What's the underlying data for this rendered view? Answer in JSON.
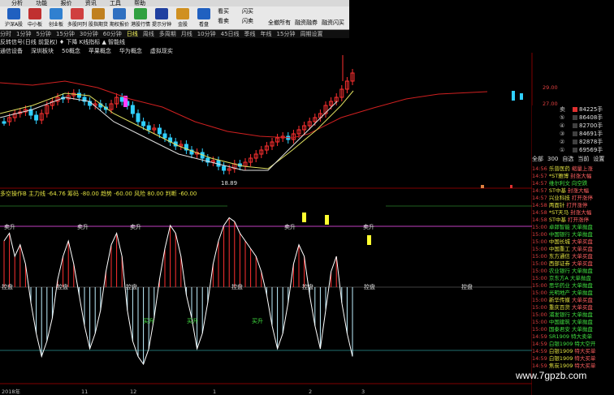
{
  "menu": [
    "分析",
    "功能",
    "报价",
    "资讯",
    "工具",
    "帮助"
  ],
  "toolbar_buttons": [
    {
      "label": "沪深A股",
      "color": "#2060c0"
    },
    {
      "label": "中小板",
      "color": "#c03030"
    },
    {
      "label": "创业板",
      "color": "#3080d0"
    },
    {
      "label": "多股同列",
      "color": "#d04040"
    },
    {
      "label": "股指期货",
      "color": "#c08020"
    },
    {
      "label": "期权报价",
      "color": "#3070c0"
    },
    {
      "label": "港股行情",
      "color": "#30a040"
    },
    {
      "label": "提示分钟",
      "color": "#2040a0"
    },
    {
      "label": "金股",
      "color": "#d09020"
    },
    {
      "label": "看盘",
      "color": "#2060c0"
    }
  ],
  "toolbar_extra": [
    "看买",
    "看卖",
    "闪买",
    "闪卖",
    "全撤所有",
    "融资融券",
    "融资闪买"
  ],
  "period_tabs": [
    "分时",
    "1分钟",
    "5分钟",
    "15分钟",
    "30分钟",
    "60分钟",
    "日线",
    "周线",
    "多周期",
    "月线",
    "10分钟",
    "45日线",
    "季线",
    "年线",
    "15分钟",
    "周期设置"
  ],
  "chart_header": "反转信号(日线 前复权)  ♦ 下降 K线指标  ▲ 智能线",
  "sector_tabs": [
    "通信设备",
    "深圳板块",
    "50概念",
    "苹果概念",
    "华为概念",
    "虚拟现实"
  ],
  "indicator_header": "多空操作B  主力线 -64.76  筹码 -80.00  趋势 -60.00  风险 80.00  判断 -60.00",
  "price_label": "18.89",
  "labels": {
    "sell": "卖升",
    "control": "控盘",
    "buy": "买升"
  },
  "axis_right_price": [
    "29.00",
    "27.00",
    "25.00",
    "23.00",
    "21.00",
    "19.00"
  ],
  "axis_right_ind": [
    "80.00",
    "60.00",
    "40.00",
    "20.00",
    "0.00",
    "-20.00",
    "-40.00",
    "-60.00"
  ],
  "orderbook_sell": [
    {
      "label": "卖",
      "price": "",
      "vol": "84225手"
    },
    {
      "label": "⑤",
      "price": "",
      "vol": "86408手"
    },
    {
      "label": "④",
      "price": "",
      "vol": "82700手"
    },
    {
      "label": "③",
      "price": "",
      "vol": "84691手"
    },
    {
      "label": "②",
      "price": "",
      "vol": "82878手"
    },
    {
      "label": "①",
      "price": "",
      "vol": "69569手"
    }
  ],
  "panel_tabs": [
    "全部",
    "300",
    "自选",
    "当前",
    "设置"
  ],
  "ticks": [
    {
      "time": "14:56",
      "name": "乐普医药",
      "desc": "缩量上涨"
    },
    {
      "time": "14:57",
      "name": "*ST雅博",
      "desc": "封涨大幅"
    },
    {
      "time": "14:57",
      "name": "维尔利文",
      "desc": "向空跌"
    },
    {
      "time": "14:57",
      "name": "ST中基",
      "desc": "封涨大幅"
    },
    {
      "time": "14:57",
      "name": "兴业科技",
      "desc": "打开涨停"
    },
    {
      "time": "14:58",
      "name": "两面针",
      "desc": "打开涨停"
    },
    {
      "time": "14:58",
      "name": "*ST天马",
      "desc": "封涨大幅"
    },
    {
      "time": "14:58",
      "name": "ST中基",
      "desc": "打开涨停"
    },
    {
      "time": "15:00",
      "name": "卓郎智能",
      "desc": "大单抛盘"
    },
    {
      "time": "15:00",
      "name": "中国银行",
      "desc": "大单抛盘"
    },
    {
      "time": "15:00",
      "name": "中国长城",
      "desc": "大单买盘"
    },
    {
      "time": "15:00",
      "name": "中国重工",
      "desc": "大单买盘"
    },
    {
      "time": "15:00",
      "name": "东方通信",
      "desc": "大单买盘"
    },
    {
      "time": "15:00",
      "name": "西部证券",
      "desc": "大单买盘"
    },
    {
      "time": "15:00",
      "name": "农业银行",
      "desc": "大单抛盘"
    },
    {
      "time": "15:00",
      "name": "京东方A",
      "desc": "大单抛盘"
    },
    {
      "time": "15:00",
      "name": "思华药业",
      "desc": "大单抛盘"
    },
    {
      "time": "15:00",
      "name": "光明地产",
      "desc": "大单抛盘"
    },
    {
      "time": "15:00",
      "name": "新华传媒",
      "desc": "大单买盘"
    },
    {
      "time": "15:00",
      "name": "重庆百货",
      "desc": "大单买盘"
    },
    {
      "time": "15:00",
      "name": "浦发银行",
      "desc": "大单抛盘"
    },
    {
      "time": "15:00",
      "name": "中国建筑",
      "desc": "大单抛盘"
    },
    {
      "time": "15:00",
      "name": "国泰君安",
      "desc": "大单抛盘"
    },
    {
      "time": "14:59",
      "name": "SR1909",
      "desc": "特大卖单"
    },
    {
      "time": "14:59",
      "name": "白银1909",
      "desc": "特大空开"
    },
    {
      "time": "14:59",
      "name": "白银1909",
      "desc": "特大买单"
    },
    {
      "time": "14:59",
      "name": "白银1909",
      "desc": "特大买单"
    },
    {
      "time": "14:59",
      "name": "焦炭1909",
      "desc": "特大买单"
    }
  ],
  "date_axis": [
    "2018年",
    "11",
    "12",
    "1",
    "2",
    "3"
  ],
  "watermark": "www.7gpzb.com",
  "colors": {
    "up": "#ff3030",
    "down": "#30c0ff",
    "ma_white": "#e0e0e0",
    "ma_yellow": "#e0e060",
    "ma_red": "#d02020"
  }
}
